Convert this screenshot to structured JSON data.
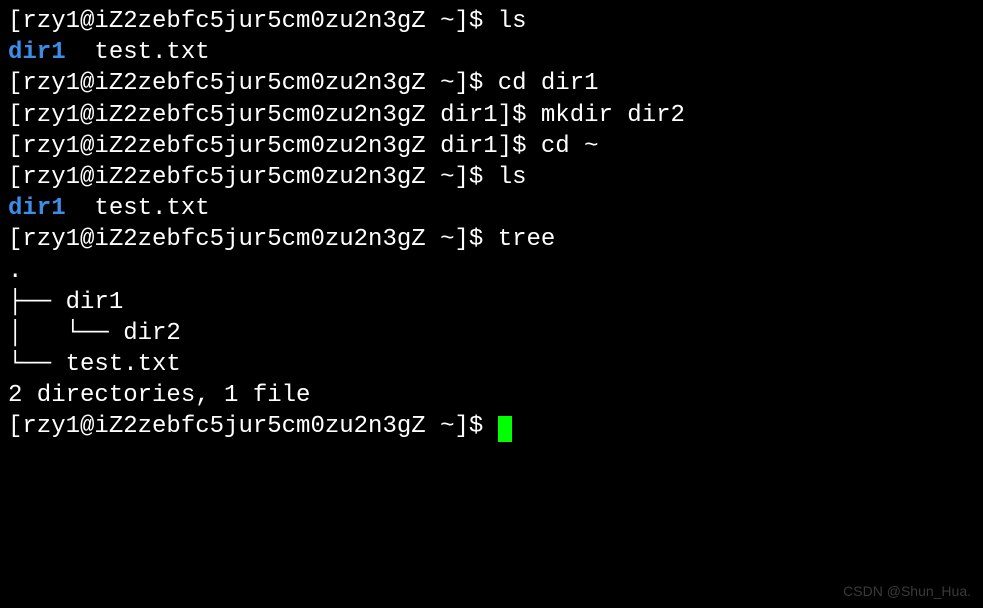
{
  "prompt_user": "rzy1",
  "prompt_host": "iZ2zebfc5jur5cm0zu2n3gZ",
  "lines": {
    "l1_prompt": "[rzy1@iZ2zebfc5jur5cm0zu2n3gZ ~]$ ",
    "l1_cmd": "ls",
    "l2_dir": "dir1",
    "l2_rest": "  test.txt",
    "l3_prompt": "[rzy1@iZ2zebfc5jur5cm0zu2n3gZ ~]$ ",
    "l3_cmd": "cd dir1",
    "l4_prompt": "[rzy1@iZ2zebfc5jur5cm0zu2n3gZ dir1]$ ",
    "l4_cmd": "mkdir dir2",
    "l5_prompt": "[rzy1@iZ2zebfc5jur5cm0zu2n3gZ dir1]$ ",
    "l5_cmd": "cd ~",
    "l6_prompt": "[rzy1@iZ2zebfc5jur5cm0zu2n3gZ ~]$ ",
    "l6_cmd": "ls",
    "l7_dir": "dir1",
    "l7_rest": "  test.txt",
    "l8_prompt": "[rzy1@iZ2zebfc5jur5cm0zu2n3gZ ~]$ ",
    "l8_cmd": "tree",
    "tree_root": ".",
    "tree_l1_branch": "├── ",
    "tree_l1_name": "dir1",
    "tree_l2": "│   └── dir2",
    "tree_l3": "└── test.txt",
    "tree_blank": "",
    "tree_summary": "2 directories, 1 file",
    "final_prompt": "[rzy1@iZ2zebfc5jur5cm0zu2n3gZ ~]$ "
  },
  "watermark": "CSDN @Shun_Hua."
}
